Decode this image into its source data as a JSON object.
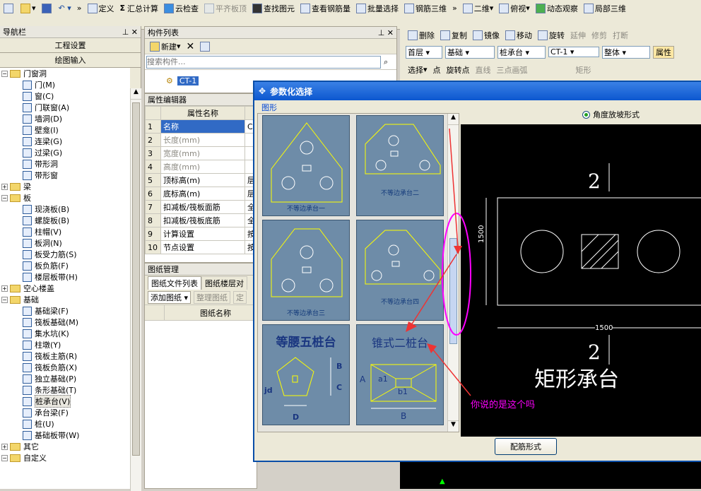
{
  "toolbar": {
    "row1": [
      "定义",
      "汇总计算",
      "云检查",
      "平齐板顶",
      "查找图元",
      "查看钢筋量",
      "批量选择",
      "钢筋三维",
      "二维",
      "俯视",
      "动态观察",
      "局部三维"
    ],
    "row2": [
      "删除",
      "复制",
      "镜像",
      "移动",
      "旋转",
      "延伸",
      "修剪",
      "打断"
    ],
    "selects": {
      "floor": "首层",
      "category": "基础",
      "type": "桩承台",
      "name": "CT-1",
      "scope": "整体",
      "attr": "属性"
    },
    "row3": [
      "选择",
      "点",
      "旋转点",
      "直线",
      "三点画弧",
      "矩形"
    ]
  },
  "nav": {
    "title": "导航栏",
    "btn1": "工程设置",
    "btn2": "绘图输入"
  },
  "tree": [
    {
      "label": "门窗洞",
      "level": 0,
      "type": "folder",
      "open": true
    },
    {
      "label": "门(M)",
      "level": 1
    },
    {
      "label": "窗(C)",
      "level": 1
    },
    {
      "label": "门联窗(A)",
      "level": 1
    },
    {
      "label": "墙洞(D)",
      "level": 1
    },
    {
      "label": "壁龛(I)",
      "level": 1
    },
    {
      "label": "连梁(G)",
      "level": 1
    },
    {
      "label": "过梁(G)",
      "level": 1
    },
    {
      "label": "带形洞",
      "level": 1
    },
    {
      "label": "带形窗",
      "level": 1
    },
    {
      "label": "梁",
      "level": 0,
      "type": "folder",
      "open": false
    },
    {
      "label": "板",
      "level": 0,
      "type": "folder",
      "open": true
    },
    {
      "label": "现浇板(B)",
      "level": 1
    },
    {
      "label": "螺旋板(B)",
      "level": 1
    },
    {
      "label": "柱帽(V)",
      "level": 1
    },
    {
      "label": "板洞(N)",
      "level": 1
    },
    {
      "label": "板受力筋(S)",
      "level": 1
    },
    {
      "label": "板负筋(F)",
      "level": 1
    },
    {
      "label": "楼层板带(H)",
      "level": 1
    },
    {
      "label": "空心楼盖",
      "level": 0,
      "type": "folder",
      "open": false
    },
    {
      "label": "基础",
      "level": 0,
      "type": "folder",
      "open": true
    },
    {
      "label": "基础梁(F)",
      "level": 1
    },
    {
      "label": "筏板基础(M)",
      "level": 1
    },
    {
      "label": "集水坑(K)",
      "level": 1
    },
    {
      "label": "柱墩(Y)",
      "level": 1
    },
    {
      "label": "筏板主筋(R)",
      "level": 1
    },
    {
      "label": "筏板负筋(X)",
      "level": 1
    },
    {
      "label": "独立基础(P)",
      "level": 1
    },
    {
      "label": "条形基础(T)",
      "level": 1
    },
    {
      "label": "桩承台(V)",
      "level": 1,
      "selected": true
    },
    {
      "label": "承台梁(F)",
      "level": 1
    },
    {
      "label": "桩(U)",
      "level": 1
    },
    {
      "label": "基础板带(W)",
      "level": 1
    },
    {
      "label": "其它",
      "level": 0,
      "type": "folder",
      "open": false
    },
    {
      "label": "自定义",
      "level": 0,
      "type": "folder",
      "open": true
    }
  ],
  "complist": {
    "title": "构件列表",
    "new_label": "新建",
    "search_placeholder": "搜索构件...",
    "item": "CT-1"
  },
  "props": {
    "title": "属性编辑器",
    "header": "属性名称",
    "rows": [
      {
        "n": "1",
        "name": "名称",
        "val": "C",
        "gray": false,
        "sel": true
      },
      {
        "n": "2",
        "name": "长度(mm)",
        "val": "",
        "gray": true
      },
      {
        "n": "3",
        "name": "宽度(mm)",
        "val": "",
        "gray": true
      },
      {
        "n": "4",
        "name": "高度(mm)",
        "val": "",
        "gray": true
      },
      {
        "n": "5",
        "name": "顶标高(m)",
        "val": "层",
        "gray": false
      },
      {
        "n": "6",
        "name": "底标高(m)",
        "val": "层",
        "gray": false
      },
      {
        "n": "7",
        "name": "扣减板/筏板面筋",
        "val": "全",
        "gray": false
      },
      {
        "n": "8",
        "name": "扣减板/筏板底筋",
        "val": "全",
        "gray": false
      },
      {
        "n": "9",
        "name": "计算设置",
        "val": "按",
        "gray": false
      },
      {
        "n": "10",
        "name": "节点设置",
        "val": "按",
        "gray": false
      }
    ]
  },
  "drawings": {
    "title": "图纸管理",
    "tab1": "图纸文件列表",
    "tab2": "图纸楼层对",
    "add": "添加图纸",
    "arrange": "整理图纸",
    "locate": "定",
    "col": "图纸名称"
  },
  "dialog": {
    "title": "参数化选择",
    "group": "图形",
    "radio": "角度放坡形式",
    "rebar_btn": "配筋形式",
    "thumbs": [
      "不等边承台一",
      "不等边承台二",
      "不等边承台三",
      "不等边承台四",
      "等腰五桩台",
      "锥式二桩台"
    ],
    "cad": {
      "section": "2",
      "dim_h": "1500",
      "dim_w": "1500",
      "caption": "矩形承台"
    }
  },
  "annotation": "你说的是这个吗",
  "pentagon_labels": {
    "B": "B",
    "C": "C",
    "D": "D",
    "jd": "jd"
  },
  "cone_labels": {
    "A": "A",
    "a1": "a1",
    "b1": "b1",
    "B": "B"
  }
}
